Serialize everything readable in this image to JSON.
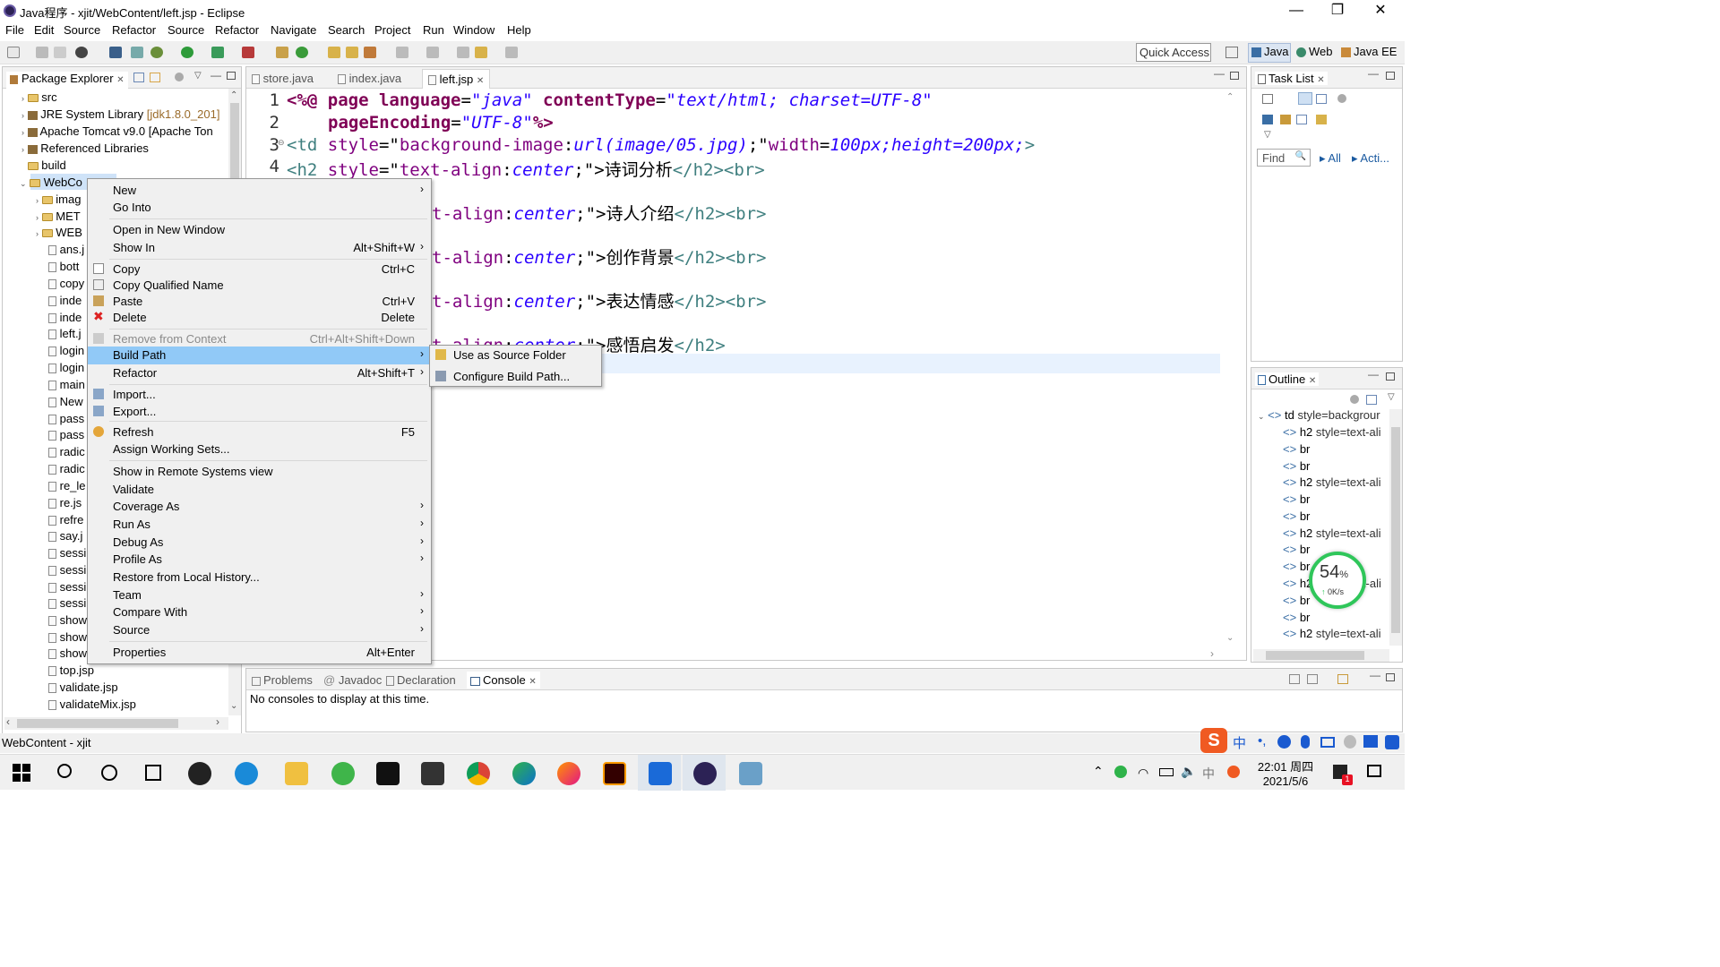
{
  "title_bar": {
    "title": "Java程序 - xjit/WebContent/left.jsp - Eclipse"
  },
  "menu": [
    "File",
    "Edit",
    "Source",
    "Refactor",
    "Source",
    "Refactor",
    "Navigate",
    "Search",
    "Project",
    "Run",
    "Window",
    "Help"
  ],
  "toolbar": {
    "quick_access": "Quick Access"
  },
  "perspectives": [
    "Java",
    "Web",
    "Java EE"
  ],
  "package_explorer": {
    "tab": "Package Explorer",
    "items": [
      "src",
      "JRE System Library",
      "Apache Tomcat v9.0 [Apache Ton",
      "Referenced Libraries",
      "build",
      "WebCo",
      "imag",
      "MET",
      "WEB",
      "ans.j",
      "bott",
      "copy",
      "inde",
      "inde",
      "left.j",
      "login",
      "login",
      "main",
      "New",
      "pass",
      "pass",
      "radic",
      "radic",
      "re_le",
      "re.js",
      "refre",
      "say.j",
      "sessi",
      "sessi",
      "sessi",
      "sessi",
      "show",
      "show",
      "show",
      "top.jsp",
      "validate.jsp",
      "validateMix.jsp"
    ],
    "jre_version": "[jdk1.8.0_201]"
  },
  "editor": {
    "tabs": [
      "store.java",
      "index.java",
      "left.jsp"
    ],
    "line_numbers": [
      "1",
      "2",
      "3",
      "4"
    ],
    "fold_marker": "⊖",
    "code": {
      "l1_a": "<%@",
      "l1_b": " page ",
      "l1_c": "language",
      "l1_d": "=",
      "l1_e": "\"java\"",
      "l1_f": " contentType",
      "l1_g": "\"text/html; charset=UTF-8\"",
      "l2_a": "pageEncoding",
      "l2_b": "\"UTF-8\"",
      "l2_c": "%>",
      "l3_a": "<td ",
      "l3_b": "style",
      "l3_c": "\"",
      "l3_d": "background-image",
      "l3_e": ":",
      "l3_f": "url(image/05.jpg)",
      "l3_g": ";\"",
      "l3_h": "width",
      "l3_i": "=",
      "l3_j": "100px;height=200px;",
      "l3_k": ">",
      "l4_a": "<h2 ",
      "l4_b": "style",
      "l4_c": "=\"",
      "l4_d": "text-align",
      "l4_e": ":",
      "l4_f": "center",
      "l4_g": ";\">",
      "l4_h": "诗词分析",
      "l4_i": "</h2><br>",
      "r1_a": "t-align",
      "r1_c": "center",
      "r1_d": ";\">",
      "r1_e": "诗人介绍",
      "r1_f": "</h2><br>",
      "r2_e": "创作背景",
      "r3_e": "表达情感",
      "r4_e": "感悟启发",
      "r4_f": "</h2>"
    }
  },
  "context_menu": {
    "items": [
      {
        "label": "New",
        "shortcut": "",
        "arrow": "›"
      },
      {
        "label": "Go Into",
        "shortcut": "",
        "arrow": ""
      },
      {
        "label": "Open in New Window",
        "shortcut": "",
        "arrow": ""
      },
      {
        "label": "Show In",
        "shortcut": "Alt+Shift+W",
        "arrow": "›"
      },
      {
        "label": "Copy",
        "shortcut": "Ctrl+C",
        "arrow": ""
      },
      {
        "label": "Copy Qualified Name",
        "shortcut": "",
        "arrow": ""
      },
      {
        "label": "Paste",
        "shortcut": "Ctrl+V",
        "arrow": ""
      },
      {
        "label": "Delete",
        "shortcut": "Delete",
        "arrow": ""
      },
      {
        "label": "Remove from Context",
        "shortcut": "Ctrl+Alt+Shift+Down",
        "arrow": ""
      },
      {
        "label": "Build Path",
        "shortcut": "",
        "arrow": "›"
      },
      {
        "label": "Refactor",
        "shortcut": "Alt+Shift+T",
        "arrow": "›"
      },
      {
        "label": "Import...",
        "shortcut": "",
        "arrow": ""
      },
      {
        "label": "Export...",
        "shortcut": "",
        "arrow": ""
      },
      {
        "label": "Refresh",
        "shortcut": "F5",
        "arrow": ""
      },
      {
        "label": "Assign Working Sets...",
        "shortcut": "",
        "arrow": ""
      },
      {
        "label": "Show in Remote Systems view",
        "shortcut": "",
        "arrow": ""
      },
      {
        "label": "Validate",
        "shortcut": "",
        "arrow": ""
      },
      {
        "label": "Coverage As",
        "shortcut": "",
        "arrow": "›"
      },
      {
        "label": "Run As",
        "shortcut": "",
        "arrow": "›"
      },
      {
        "label": "Debug As",
        "shortcut": "",
        "arrow": "›"
      },
      {
        "label": "Profile As",
        "shortcut": "",
        "arrow": "›"
      },
      {
        "label": "Restore from Local History...",
        "shortcut": "",
        "arrow": ""
      },
      {
        "label": "Team",
        "shortcut": "",
        "arrow": "›"
      },
      {
        "label": "Compare With",
        "shortcut": "",
        "arrow": "›"
      },
      {
        "label": "Source",
        "shortcut": "",
        "arrow": "›"
      },
      {
        "label": "Properties",
        "shortcut": "Alt+Enter",
        "arrow": ""
      }
    ],
    "submenu": [
      "Use as Source Folder",
      "Configure Build Path..."
    ]
  },
  "task_list": {
    "tab": "Task List",
    "find": "Find",
    "all": "All",
    "acti": "Acti..."
  },
  "outline": {
    "tab": "Outline",
    "items": [
      {
        "tag": "td",
        "attr": "style=backgrour"
      },
      {
        "tag": "h2",
        "attr": "style=text-ali"
      },
      {
        "tag": "br",
        "attr": ""
      },
      {
        "tag": "br",
        "attr": ""
      },
      {
        "tag": "h2",
        "attr": "style=text-ali"
      },
      {
        "tag": "br",
        "attr": ""
      },
      {
        "tag": "br",
        "attr": ""
      },
      {
        "tag": "h2",
        "attr": "style=text-ali"
      },
      {
        "tag": "br",
        "attr": ""
      },
      {
        "tag": "br",
        "attr": ""
      },
      {
        "tag": "h2",
        "attr": "t-ali"
      },
      {
        "tag": "br",
        "attr": ""
      },
      {
        "tag": "br",
        "attr": ""
      },
      {
        "tag": "h2",
        "attr": "style=text-ali"
      }
    ]
  },
  "net_widget": {
    "percent": "54",
    "unit": "%",
    "speed": "0K/s",
    "arrow": "↑"
  },
  "bottom_panel": {
    "tabs": [
      "Problems",
      "Javadoc",
      "Declaration",
      "Console"
    ],
    "message": "No consoles to display at this time."
  },
  "status": {
    "left": "WebContent - xjit"
  },
  "ime": {
    "lang": "中"
  },
  "clock": {
    "time": "22:01",
    "weekday": "周四",
    "date": "2021/5/6"
  },
  "notification_count": "1",
  "colors": {
    "selection": "#91c9f7",
    "keyword": "#7f0055",
    "string": "#2a00ff",
    "tag": "#3f7f7f"
  }
}
